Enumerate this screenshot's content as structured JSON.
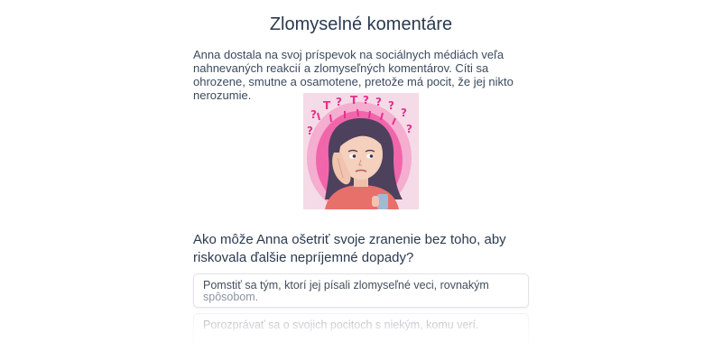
{
  "page": {
    "title": "Zlomyselné komentáre",
    "intro": "Anna dostala na svoj príspevok na sociálnych médiách veľa nahnevaných reakcií a zlomyseľných komentárov. Cíti sa ohrozene, smutne a osamotene, pretože má pocit, že jej nikto nerozumie."
  },
  "question": {
    "text": "Ako môže Anna ošetriť svoje zranenie bez toho, aby riskovala ďalšie nepríjemné dopady?"
  },
  "options": [
    {
      "label_main": "Pomstiť sa tým, ktorí jej písali zlomyseľné veci, rovnakým",
      "label_rest": "spôsobom."
    },
    {
      "label_main": "Porozprávať sa o svojich pocitoch s niekým, komu verí.",
      "label_rest": ""
    }
  ],
  "illustration": {
    "icon": "worried-girl-illustration",
    "colors": {
      "background": "#f6d7e6",
      "glow": "#f0409a",
      "hair": "#4b3f5c",
      "skin": "#f3cdb8",
      "shirt": "#e8706a",
      "phone": "#a9c2dc"
    }
  }
}
